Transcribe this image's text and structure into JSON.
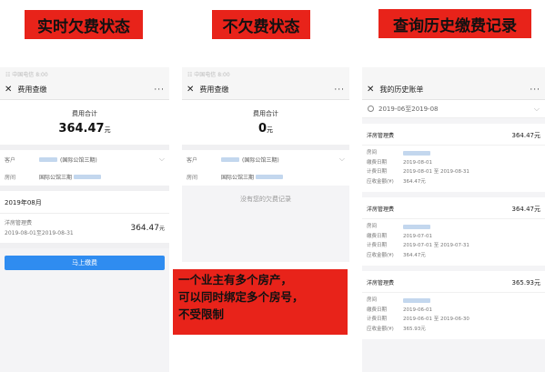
{
  "banners": {
    "current": "实时欠费状态",
    "none": "不欠费状态",
    "history": "查询历史缴费记录"
  },
  "callout": {
    "line1": "一个业主有多个房产，",
    "line2": "可以同时绑定多个房号，",
    "line3": "不受限制"
  },
  "phone1": {
    "status": "☷ 中国电信 8:00",
    "title": "费用查缴",
    "more": "···",
    "total_label": "费用合计",
    "total_amount": "364.47",
    "unit": "元",
    "customer_label": "客户",
    "customer_value": "(国际公馆三期)",
    "house_label": "房间",
    "house_value": "国际公馆三期",
    "month": "2019年08月",
    "bill_name": "洋房管理费",
    "bill_period": "2019-08-01至2019-08-31",
    "bill_amount": "364.47",
    "pay_button": "马上缴费"
  },
  "phone2": {
    "status": "☷ 中国电信 8:00",
    "title": "费用查缴",
    "more": "···",
    "total_label": "费用合计",
    "total_amount": "0",
    "unit": "元",
    "customer_label": "客户",
    "customer_value": "(国际公馆三期)",
    "house_label": "房间",
    "house_value": "国际公馆三期",
    "empty": "没有您的欠费记录"
  },
  "phone3": {
    "title": "我的历史账单",
    "more": "···",
    "range": "2019-06至2019-08",
    "labels": {
      "room": "房间",
      "date": "缴费日期",
      "period": "计费日期",
      "due": "应收金额(¥)"
    },
    "records": [
      {
        "name": "洋房管理费",
        "amount": "364.47元",
        "date": "2019-08-01",
        "period": "2019-08-01 至 2019-08-31",
        "due": "364.47元"
      },
      {
        "name": "洋房管理费",
        "amount": "364.47元",
        "date": "2019-07-01",
        "period": "2019-07-01 至 2019-07-31",
        "due": "364.47元"
      },
      {
        "name": "洋房管理费",
        "amount": "365.93元",
        "date": "2019-06-01",
        "period": "2019-06-01 至 2019-06-30",
        "due": "365.93元"
      }
    ]
  }
}
